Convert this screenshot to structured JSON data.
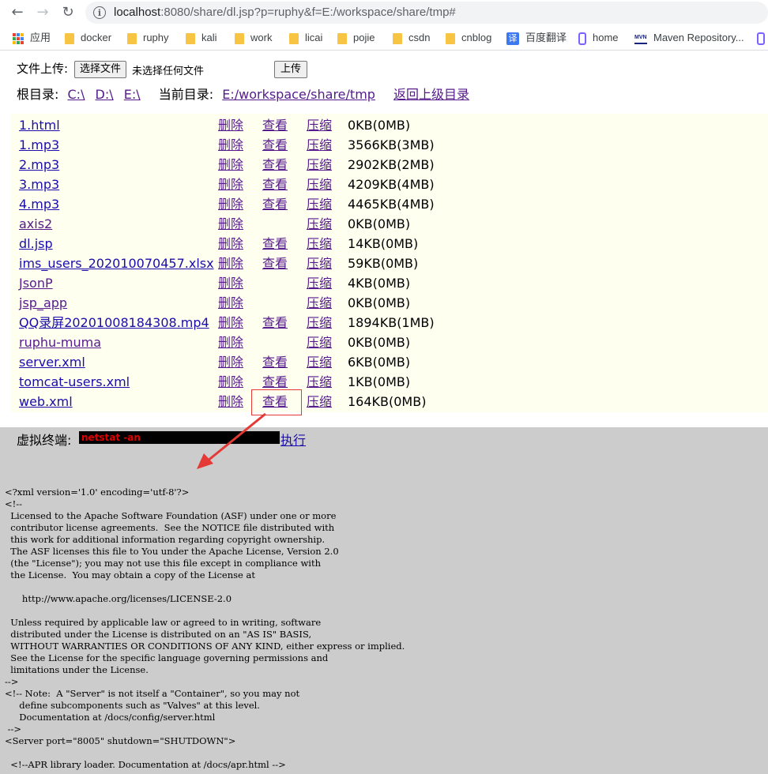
{
  "browser": {
    "url_host": "localhost",
    "url_rest": ":8080/share/dl.jsp?p=ruphy&f=E:/workspace/share/tmp#",
    "bookmarks": [
      {
        "label": "应用"
      },
      {
        "label": "docker"
      },
      {
        "label": "ruphy"
      },
      {
        "label": "kali"
      },
      {
        "label": "work"
      },
      {
        "label": "licai"
      },
      {
        "label": "pojie"
      },
      {
        "label": "csdn"
      },
      {
        "label": "cnblog"
      },
      {
        "label": "百度翻译"
      },
      {
        "label": "home"
      },
      {
        "label": "Maven Repository..."
      }
    ]
  },
  "upload": {
    "label": "文件上传:",
    "choose_button": "选择文件",
    "no_file_text": "未选择任何文件",
    "submit_button": "上传"
  },
  "nav": {
    "root_label": "根目录:",
    "roots": [
      "C:\\",
      "D:\\",
      "E:\\"
    ],
    "current_label": "当前目录:",
    "current_path": "E:/workspace/share/tmp",
    "back_link": "返回上级目录"
  },
  "actions": {
    "delete": "删除",
    "view": "查看",
    "zip": "压缩"
  },
  "files": [
    {
      "name": "1.html",
      "view": true,
      "size": "0KB(0MB)"
    },
    {
      "name": "1.mp3",
      "view": true,
      "size": "3566KB(3MB)"
    },
    {
      "name": "2.mp3",
      "view": true,
      "size": "2902KB(2MB)"
    },
    {
      "name": "3.mp3",
      "view": true,
      "size": "4209KB(4MB)"
    },
    {
      "name": "4.mp3",
      "view": true,
      "size": "4465KB(4MB)"
    },
    {
      "name": "axis2",
      "view": false,
      "size": "0KB(0MB)"
    },
    {
      "name": "dl.jsp",
      "view": true,
      "size": "14KB(0MB)"
    },
    {
      "name": "ims_users_202010070457.xlsx",
      "view": true,
      "size": "59KB(0MB)"
    },
    {
      "name": "JsonP",
      "view": false,
      "size": "4KB(0MB)"
    },
    {
      "name": "jsp_app",
      "view": false,
      "size": "0KB(0MB)"
    },
    {
      "name": "QQ录屏20201008184308.mp4",
      "view": true,
      "size": "1894KB(1MB)"
    },
    {
      "name": "ruphu-muma",
      "view": false,
      "size": "0KB(0MB)"
    },
    {
      "name": "server.xml",
      "view": true,
      "size": "6KB(0MB)"
    },
    {
      "name": "tomcat-users.xml",
      "view": true,
      "size": "1KB(0MB)"
    },
    {
      "name": "web.xml",
      "view": true,
      "size": "164KB(0MB)"
    }
  ],
  "terminal": {
    "label": "虚拟终端:",
    "command": "netstat -an",
    "exec_link": "执行",
    "output": "<?xml version='1.0' encoding='utf-8'?>\n<!--\n  Licensed to the Apache Software Foundation (ASF) under one or more\n  contributor license agreements.  See the NOTICE file distributed with\n  this work for additional information regarding copyright ownership.\n  The ASF licenses this file to You under the Apache License, Version 2.0\n  (the \"License\"); you may not use this file except in compliance with\n  the License.  You may obtain a copy of the License at\n\n      http://www.apache.org/licenses/LICENSE-2.0\n\n  Unless required by applicable law or agreed to in writing, software\n  distributed under the License is distributed on an \"AS IS\" BASIS,\n  WITHOUT WARRANTIES OR CONDITIONS OF ANY KIND, either express or implied.\n  See the License for the specific language governing permissions and\n  limitations under the License.\n-->\n<!-- Note:  A \"Server\" is not itself a \"Container\", so you may not\n     define subcomponents such as \"Valves\" at this level.\n     Documentation at /docs/config/server.html\n -->\n<Server port=\"8005\" shutdown=\"SHUTDOWN\">\n\n  <!--APR library loader. Documentation at /docs/apr.html -->"
  }
}
